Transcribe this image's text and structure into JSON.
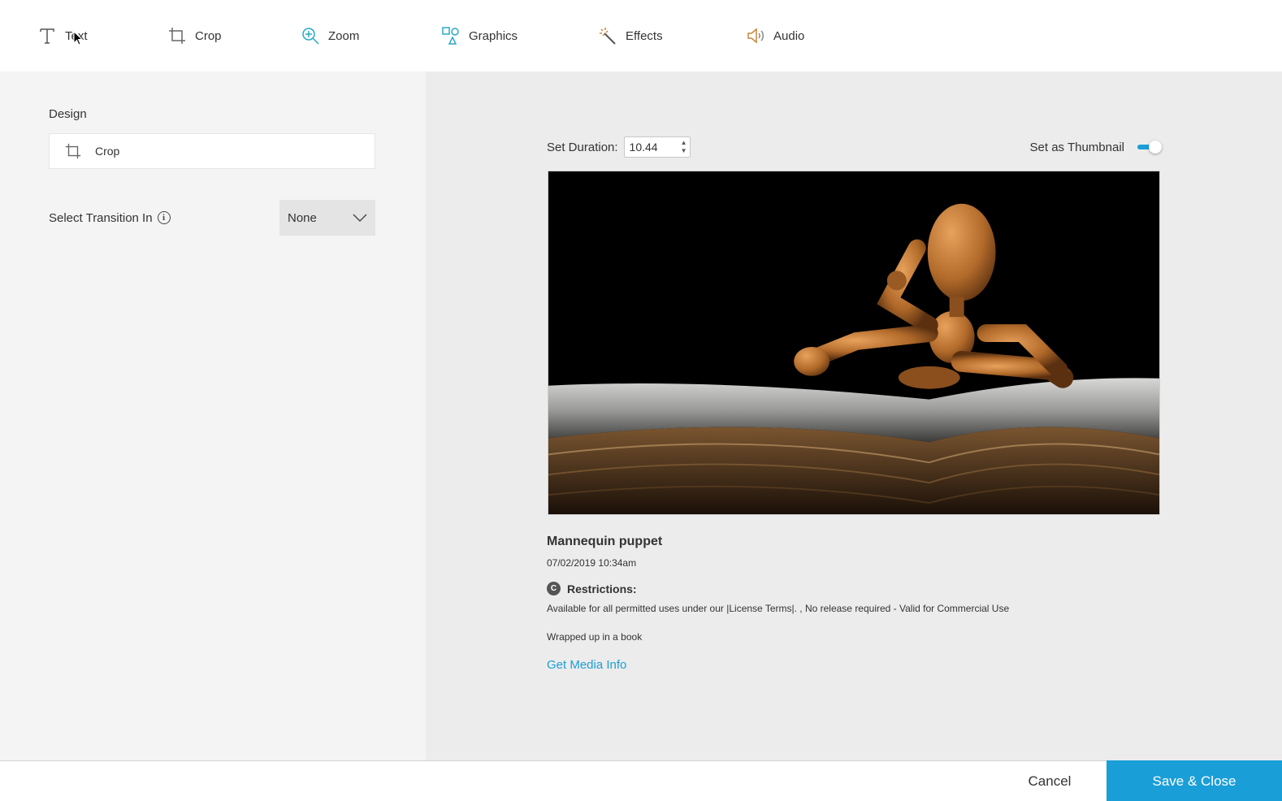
{
  "toolbar": {
    "items": [
      {
        "label": "Text",
        "icon": "text-icon"
      },
      {
        "label": "Crop",
        "icon": "crop-icon"
      },
      {
        "label": "Zoom",
        "icon": "zoom-icon"
      },
      {
        "label": "Graphics",
        "icon": "graphics-icon"
      },
      {
        "label": "Effects",
        "icon": "effects-icon"
      },
      {
        "label": "Audio",
        "icon": "audio-icon"
      }
    ]
  },
  "left": {
    "design_label": "Design",
    "design_item": "Crop",
    "transition_label": "Select Transition In",
    "transition_value": "None"
  },
  "right": {
    "duration_label": "Set Duration:",
    "duration_value": "10.44",
    "thumbnail_label": "Set as Thumbnail",
    "thumbnail_on": true,
    "media_title": "Mannequin puppet",
    "media_date": "07/02/2019 10:34am",
    "restrictions_badge": "C",
    "restrictions_label": "Restrictions:",
    "restrictions_text": "Available for all permitted uses under our |License Terms|. , No release required - Valid for Commercial Use",
    "caption": "Wrapped up in a book",
    "media_info_link": "Get Media Info"
  },
  "footer": {
    "cancel_label": "Cancel",
    "save_label": "Save & Close"
  },
  "colors": {
    "accent": "#1a9ed8",
    "icon_teal": "#2aa8c6",
    "icon_gold": "#c8863a"
  }
}
